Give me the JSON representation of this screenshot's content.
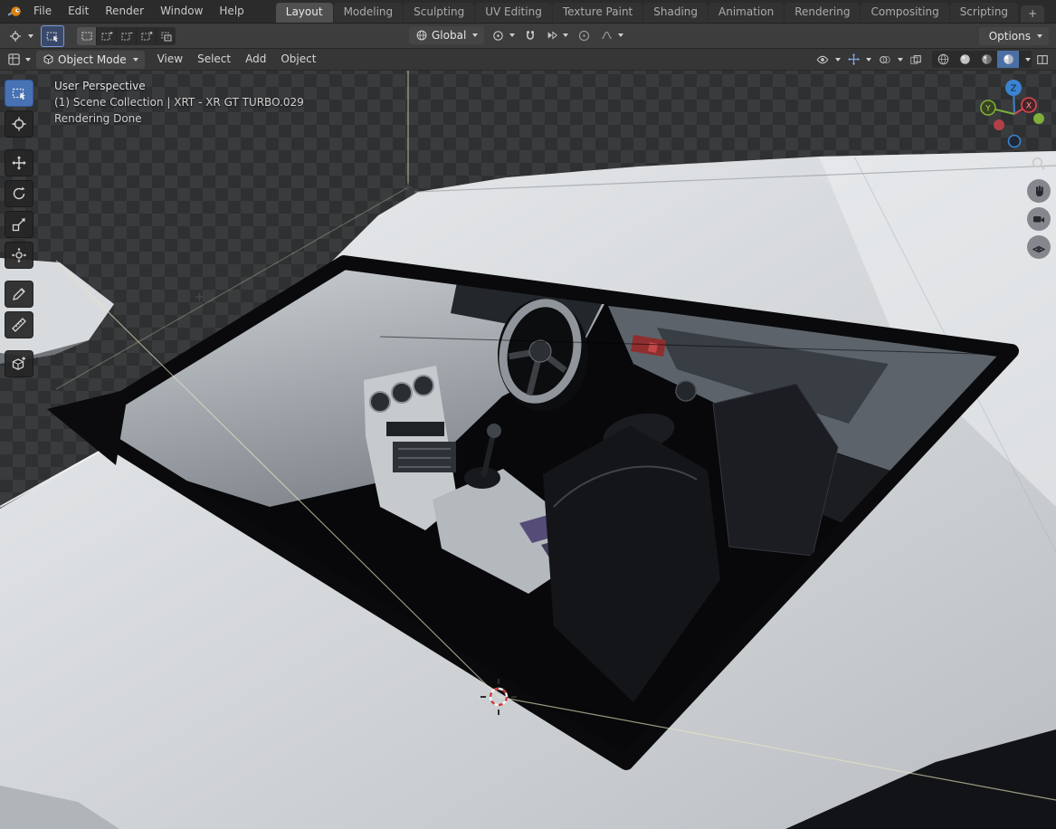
{
  "topbar": {
    "menus": [
      {
        "label": "File"
      },
      {
        "label": "Edit"
      },
      {
        "label": "Render"
      },
      {
        "label": "Window"
      },
      {
        "label": "Help"
      }
    ],
    "tabs": [
      {
        "label": "Layout"
      },
      {
        "label": "Modeling"
      },
      {
        "label": "Sculpting"
      },
      {
        "label": "UV Editing"
      },
      {
        "label": "Texture Paint"
      },
      {
        "label": "Shading"
      },
      {
        "label": "Animation"
      },
      {
        "label": "Rendering"
      },
      {
        "label": "Compositing"
      },
      {
        "label": "Scripting"
      }
    ],
    "active_tab": "Layout",
    "add_tab_label": "+"
  },
  "tool_settings": {
    "orientation_value": "Global",
    "options_label": "Options"
  },
  "header": {
    "mode_value": "Object Mode",
    "menus": [
      {
        "label": "View"
      },
      {
        "label": "Select"
      },
      {
        "label": "Add"
      },
      {
        "label": "Object"
      }
    ]
  },
  "viewport": {
    "info_line_1": "User Perspective",
    "info_line_2": "(1) Scene Collection | XRT - XR GT TURBO.029",
    "info_line_3": "Rendering Done",
    "axis_z": "Z",
    "axis_y": "Y",
    "axis_x": "X"
  },
  "icons": {
    "blender-logo": "orange-swirl-circle",
    "dropdown-arrow": "triangle-down",
    "magnet": "horseshoe-shape",
    "proportional": "circle-with-dot",
    "falloff": "sine-curve",
    "globe": "circle-with-meridians"
  },
  "colors": {
    "accent": "#4772b3",
    "axis_x": "#d9494f",
    "axis_y": "#7fae3a",
    "axis_z": "#3b83d0",
    "viewport_checker_dark": "#2f3032",
    "viewport_checker_light": "#3a3b3d",
    "car_body": "#d7dadd"
  }
}
